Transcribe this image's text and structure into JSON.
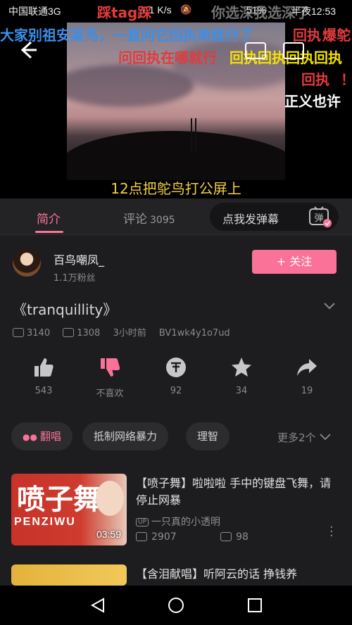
{
  "status_bar": {
    "carrier": "中国联通3G",
    "speed": "1.1 K/s",
    "battery": "51%",
    "time": "半夜12:53"
  },
  "danmaku": [
    {
      "text": "踩tag踩",
      "color": "#e23b3b"
    },
    {
      "text": "你选深我选深了",
      "color": "#cfcfcf"
    },
    {
      "text": "大家别祖安某鸟，一直问它回执单就行了",
      "color": "#3b8fe8"
    },
    {
      "text": "回执",
      "color": "#e23b3b"
    },
    {
      "text": "爆鸵",
      "color": "#e23b3b"
    },
    {
      "text": "问回执在哪就行",
      "color": "#e23b3b"
    },
    {
      "text": "回执回执回执回执",
      "color": "#f4e200"
    },
    {
      "text": "回执",
      "color": "#e23b3b"
    },
    {
      "text": "！",
      "color": "#e23b3b"
    },
    {
      "text": "正义也许",
      "color": "#ffffff"
    }
  ],
  "video": {
    "subtitle": "12点把鸵鸟打公屏上"
  },
  "tabs": {
    "intro": "简介",
    "comments": "评论",
    "comments_count": "3095",
    "danmu_button": "点我发弹幕",
    "danmu_icon_char": "弹"
  },
  "author": {
    "name": "百鸟嘲凤_",
    "fans": "1.1万粉丝",
    "follow_label": "+ 关注"
  },
  "video_info": {
    "title": "《tranquillity》",
    "plays": "3140",
    "danmu_count": "1308",
    "time_ago": "3小时前",
    "bvid": "BV1wk4y1o7ud"
  },
  "actions": [
    {
      "name": "like",
      "icon": "thumbs-up-icon",
      "label": "543"
    },
    {
      "name": "dislike",
      "icon": "thumbs-down-icon",
      "label": "不喜欢"
    },
    {
      "name": "coin",
      "icon": "coin-icon",
      "label": "92"
    },
    {
      "name": "favorite",
      "icon": "star-icon",
      "label": "34"
    },
    {
      "name": "share",
      "icon": "share-icon",
      "label": "19"
    }
  ],
  "tags": [
    {
      "label": "翻唱",
      "accent": true
    },
    {
      "label": "抵制网络暴力",
      "accent": false
    },
    {
      "label": "理智",
      "accent": false
    }
  ],
  "more_tags": "更多2个",
  "recommendations": [
    {
      "title": "【喷子舞】啦啦啦 手中的键盘飞舞，请停止网暴",
      "thumb_text": "喷子舞",
      "thumb_sub": "PENZIWU",
      "duration": "03:59",
      "uploader": "一只真的小透明",
      "plays": "2907",
      "danmu": "98"
    },
    {
      "title": "【含泪献唱】听阿云的话 挣钱养",
      "thumb_text": "",
      "duration": "",
      "uploader": "",
      "plays": "",
      "danmu": ""
    }
  ],
  "colors": {
    "accent": "#fb7299",
    "background": "#1d1d1f",
    "subtitle": "#f4d03f"
  }
}
